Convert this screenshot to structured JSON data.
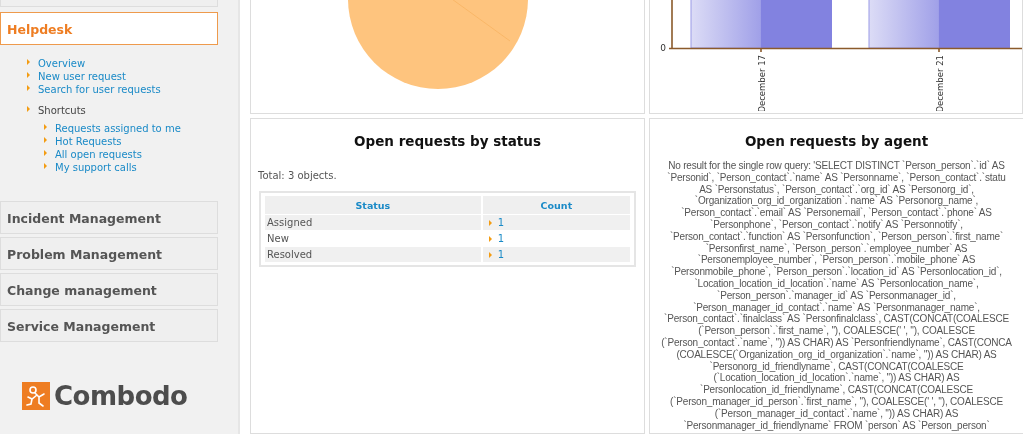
{
  "sidebar": {
    "active_menu": {
      "title": "Helpdesk",
      "expanded": true,
      "items": [
        {
          "label": "Overview"
        },
        {
          "label": "New user request"
        },
        {
          "label": "Search for user requests"
        }
      ],
      "shortcuts": {
        "label": "Shortcuts",
        "items": [
          {
            "label": "Requests assigned to me"
          },
          {
            "label": "Hot Requests"
          },
          {
            "label": "All open requests"
          },
          {
            "label": "My support calls"
          }
        ]
      }
    },
    "menus": [
      {
        "title": "Incident Management"
      },
      {
        "title": "Problem Management"
      },
      {
        "title": "Change management"
      },
      {
        "title": "Service Management"
      }
    ],
    "logo": {
      "text": "Combodo"
    }
  },
  "dashboard": {
    "bar_chart": {
      "y_tick": "0",
      "x_labels": [
        "December 17",
        "December 21"
      ]
    },
    "status_panel": {
      "title": "Open requests by status",
      "total": "Total: 3 objects.",
      "columns": [
        "Status",
        "Count"
      ],
      "rows": [
        {
          "status": "Assigned",
          "count": "1"
        },
        {
          "status": "New",
          "count": "1"
        },
        {
          "status": "Resolved",
          "count": "1"
        }
      ]
    },
    "agent_panel": {
      "title": "Open requests by agent",
      "error_lines": [
        "No result for the single row query: 'SELECT DISTINCT `Person_person`.`id` AS",
        "`Personid`, `Person_contact`.`name` AS `Personname`, `Person_contact`.`statu",
        "AS `Personstatus`, `Person_contact`.`org_id` AS `Personorg_id`,",
        "`Organization_org_id_organization`.`name` AS `Personorg_name`,",
        "`Person_contact`.`email` AS `Personemail`, `Person_contact`.`phone` AS",
        "`Personphone`, `Person_contact`.`notify` AS `Personnotify`,",
        "`Person_contact`.`function` AS `Personfunction`, `Person_person`.`first_name`",
        "`Personfirst_name`, `Person_person`.`employee_number` AS",
        "`Personemployee_number`, `Person_person`.`mobile_phone` AS",
        "`Personmobile_phone`, `Person_person`.`location_id` AS `Personlocation_id`,",
        "`Location_location_id_location`.`name` AS `Personlocation_name`,",
        "`Person_person`.`manager_id` AS `Personmanager_id`,",
        "`Person_manager_id_contact`.`name` AS `Personmanager_name`,",
        "`Person_contact`.`finalclass` AS `Personfinalclass`, CAST(CONCAT(COALESCE",
        "(`Person_person`.`first_name`, ''), COALESCE(' ', ''), COALESCE",
        "(`Person_contact`.`name`, '')) AS CHAR) AS `Personfriendlyname`, CAST(CONCA",
        "(COALESCE(`Organization_org_id_organization`.`name`, '')) AS CHAR) AS",
        "`Personorg_id_friendlyname`, CAST(CONCAT(COALESCE",
        "(`Location_location_id_location`.`name`, '')) AS CHAR) AS",
        "`Personlocation_id_friendlyname`, CAST(CONCAT(COALESCE",
        "(`Person_manager_id_person`.`first_name`, ''), COALESCE(' ', ''), COALESCE",
        "(`Person_manager_id_contact`.`name`, '')) AS CHAR) AS",
        "`Personmanager_id_friendlyname` FROM `person` AS `Person_person`"
      ]
    }
  }
}
